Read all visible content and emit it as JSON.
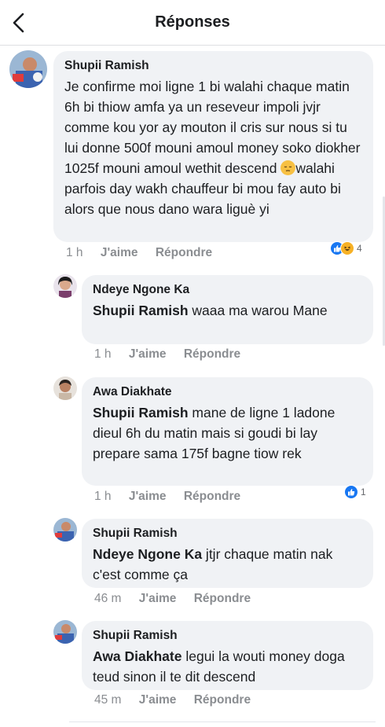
{
  "header": {
    "title": "Réponses",
    "back_icon": "chevron-left-icon"
  },
  "main_comment": {
    "author": "Shupii Ramish",
    "text_before_emoji": "Je confirme moi ligne 1 bi walahi chaque matin 6h bi thiow amfa ya un reseveur impoli jvjr comme kou yor ay mouton il cris sur nous si tu lui donne 500f mouni amoul money soko diokher 1025f mouni amoul wethit descend ",
    "emoji": "pensive-face",
    "text_after_emoji": "walahi parfois day wakh chauffeur bi mou fay auto bi alors que nous dano wara liguè yi",
    "time": "1 h",
    "like_label": "J'aime",
    "reply_label": "Répondre",
    "reactions": {
      "types": [
        "like",
        "haha"
      ],
      "count": "4"
    }
  },
  "replies": [
    {
      "author": "Ndeye Ngone Ka",
      "mention": "Shupii Ramish",
      "text": " waaa ma warou Mane",
      "time": "1 h",
      "like_label": "J'aime",
      "reply_label": "Répondre"
    },
    {
      "author": "Awa Diakhate",
      "mention": "Shupii Ramish",
      "text": " mane de ligne 1 ladone dieul 6h du matin mais si goudi bi lay prepare sama 175f bagne tiow rek",
      "time": "1 h",
      "like_label": "J'aime",
      "reply_label": "Répondre",
      "reactions": {
        "types": [
          "like"
        ],
        "count": "1"
      }
    },
    {
      "author": "Shupii Ramish",
      "mention": "Ndeye Ngone Ka",
      "text": " jtjr chaque matin nak c'est comme ça",
      "time": "46 m",
      "like_label": "J'aime",
      "reply_label": "Répondre"
    },
    {
      "author": "Shupii Ramish",
      "mention": "Awa Diakhate",
      "text": " legui la wouti money doga teud sinon il te dit descend",
      "time": "45 m",
      "like_label": "J'aime",
      "reply_label": "Répondre"
    }
  ],
  "colors": {
    "bubble": "#f0f2f5",
    "like_blue": "#1877f2",
    "haha_yellow": "#f7b125",
    "meta_gray": "#8a8d91"
  }
}
